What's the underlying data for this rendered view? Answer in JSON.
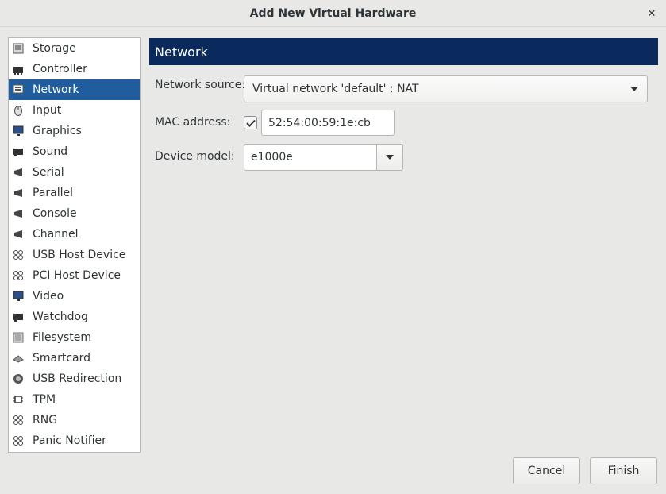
{
  "window": {
    "title": "Add New Virtual Hardware"
  },
  "sidebar": {
    "items": [
      {
        "label": "Storage",
        "icon": "storage-icon"
      },
      {
        "label": "Controller",
        "icon": "controller-icon"
      },
      {
        "label": "Network",
        "icon": "network-icon",
        "selected": true
      },
      {
        "label": "Input",
        "icon": "mouse-icon"
      },
      {
        "label": "Graphics",
        "icon": "monitor-icon"
      },
      {
        "label": "Sound",
        "icon": "sound-card-icon"
      },
      {
        "label": "Serial",
        "icon": "serial-port-icon"
      },
      {
        "label": "Parallel",
        "icon": "parallel-port-icon"
      },
      {
        "label": "Console",
        "icon": "console-port-icon"
      },
      {
        "label": "Channel",
        "icon": "channel-port-icon"
      },
      {
        "label": "USB Host Device",
        "icon": "usb-device-icon"
      },
      {
        "label": "PCI Host Device",
        "icon": "pci-device-icon"
      },
      {
        "label": "Video",
        "icon": "video-monitor-icon"
      },
      {
        "label": "Watchdog",
        "icon": "watchdog-icon"
      },
      {
        "label": "Filesystem",
        "icon": "filesystem-icon"
      },
      {
        "label": "Smartcard",
        "icon": "smartcard-icon"
      },
      {
        "label": "USB Redirection",
        "icon": "usb-redirection-icon"
      },
      {
        "label": "TPM",
        "icon": "tpm-chip-icon"
      },
      {
        "label": "RNG",
        "icon": "rng-icon"
      },
      {
        "label": "Panic Notifier",
        "icon": "panic-notifier-icon"
      }
    ]
  },
  "main": {
    "header": "Network",
    "network_source": {
      "label": "Network source:",
      "value": "Virtual network 'default' : NAT"
    },
    "mac_address": {
      "label": "MAC address:",
      "checked": true,
      "value": "52:54:00:59:1e:cb"
    },
    "device_model": {
      "label": "Device model:",
      "value": "e1000e"
    }
  },
  "buttons": {
    "cancel": "Cancel",
    "finish": "Finish"
  },
  "colors": {
    "selection": "#215d9c",
    "header_bg": "#0a2a5e",
    "window_bg": "#e8e8e7"
  }
}
